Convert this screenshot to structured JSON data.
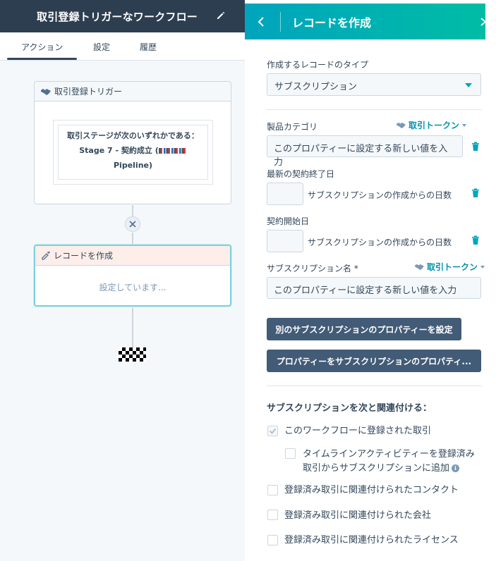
{
  "header": {
    "workflow_title": "取引登録トリガーなワークフロー"
  },
  "tabs": [
    {
      "label": "アクション"
    },
    {
      "label": "設定"
    },
    {
      "label": "履歴"
    }
  ],
  "trigger_card": {
    "title": "取引登録トリガー",
    "condition_line1": "取引ステージが次のいずれかである：",
    "condition_line2_prefix": "Stage 7 - 契約成立 (",
    "condition_line3": "Pipeline)"
  },
  "action_card": {
    "title": "レコードを作成",
    "status": "設定しています..."
  },
  "panel": {
    "title": "レコードを作成",
    "record_type_label": "作成するレコードのタイプ",
    "record_type_value": "サブスクリプション",
    "fields": [
      {
        "label": "製品カテゴリ",
        "token": "取引トークン",
        "placeholder": "このプロパティーに設定する新しい値を入力"
      },
      {
        "label": "最新の契約終了日",
        "days_text": "サブスクリプションの作成からの日数"
      },
      {
        "label": "契約開始日",
        "days_text": "サブスクリプションの作成からの日数"
      },
      {
        "label": "サブスクリプション名 *",
        "token": "取引トークン",
        "placeholder": "このプロパティーに設定する新しい値を入力"
      }
    ],
    "buttons": {
      "set_other_property": "別のサブスクリプションのプロパティーを設定",
      "copy_property": "プロパティーをサブスクリプションのプロパティ..."
    },
    "associate_title": "サブスクリプションを次と関連付ける：",
    "checkboxes": [
      {
        "label": "このワークフローに登録された取引",
        "checked": true
      },
      {
        "label_line1": "タイムラインアクティビティーを登録済み",
        "label_line2": "取引からサブスクリプションに追加",
        "checked": false
      },
      {
        "label": "登録済み取引に関連付けられたコンタクト",
        "checked": false
      },
      {
        "label": "登録済み取引に関連付けられた会社",
        "checked": false
      },
      {
        "label": "登録済み取引に関連付けられたライセンス",
        "checked": false
      }
    ]
  },
  "colors": {
    "header_bg": "#2d3e50",
    "panel_accent": "#00a4bd",
    "button_bg": "#425b76",
    "token_text": "#0091ae"
  }
}
